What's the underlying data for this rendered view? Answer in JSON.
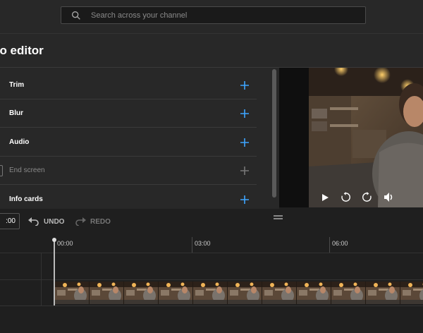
{
  "header": {
    "search_placeholder": "Search across your channel"
  },
  "page": {
    "title": "eo editor"
  },
  "editor_tools": [
    {
      "label": "Trim",
      "enabled": true
    },
    {
      "label": "Blur",
      "enabled": true
    },
    {
      "label": "Audio",
      "enabled": true
    },
    {
      "label": "End screen",
      "enabled": false
    },
    {
      "label": "Info cards",
      "enabled": true
    }
  ],
  "toolbar": {
    "time_value": ":00",
    "undo_label": "UNDO",
    "redo_label": "REDO"
  },
  "timeline": {
    "marks": [
      "00:00",
      "03:00",
      "06:00"
    ]
  },
  "colors": {
    "accent": "#3ea6ff",
    "disabled": "#8a8a8a"
  }
}
